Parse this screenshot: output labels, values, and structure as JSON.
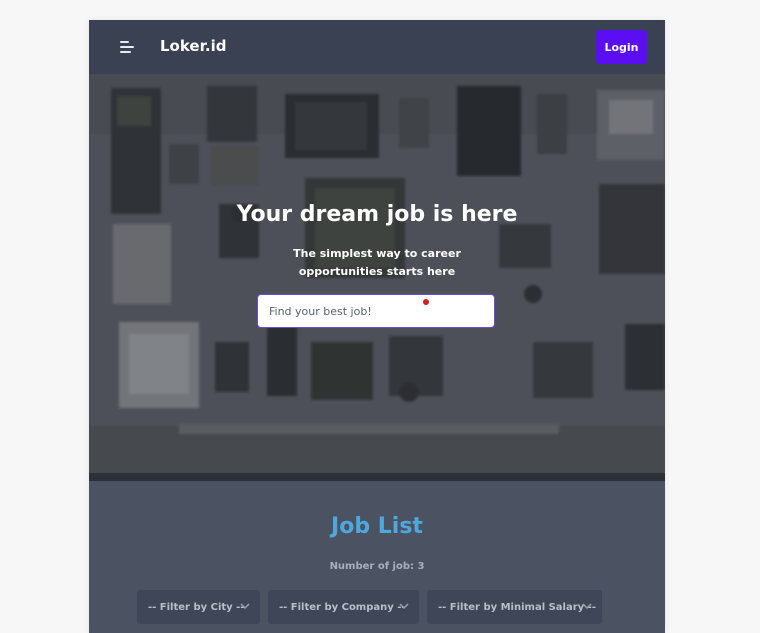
{
  "navbar": {
    "brand": "Loker.id",
    "login_label": "Login",
    "menu_icon": "hamburger-menu-icon"
  },
  "hero": {
    "title": "Your dream job is here",
    "subtitle": "The simplest way to career opportunities starts here",
    "search_placeholder": "Find your best job!",
    "search_value": ""
  },
  "jobs": {
    "title": "Job List",
    "count_text": "Number of job: 3",
    "filters": [
      {
        "label": "-- Filter by City --"
      },
      {
        "label": "-- Filter by Company --"
      },
      {
        "label": "-- Filter by Minimal Salary --"
      }
    ]
  },
  "colors": {
    "navbar": "#3a4152",
    "accent_button": "#5b0ef2",
    "job_title": "#4fa8dd",
    "section_bg": "#4b5363"
  }
}
